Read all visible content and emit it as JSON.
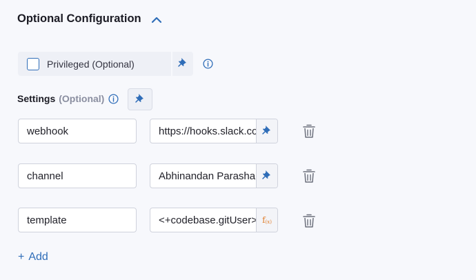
{
  "section": {
    "title": "Optional Configuration",
    "toggle_icon": "chevron-up-icon"
  },
  "privileged": {
    "label": "Privileged (Optional)",
    "checked": false
  },
  "settings": {
    "label": "Settings",
    "optional_label": "(Optional)"
  },
  "rows": [
    {
      "key": "webhook",
      "value": "https://hooks.slack.com",
      "value_mode": "pin-icon"
    },
    {
      "key": "channel",
      "value": "Abhinandan Parasharam",
      "value_mode": "pin-icon"
    },
    {
      "key": "template",
      "value": "<+codebase.gitUser>",
      "value_mode": "fx-icon"
    }
  ],
  "add": {
    "plus": "+",
    "label": "Add"
  },
  "colors": {
    "accent": "#2f6db8",
    "fx": "#e07b27",
    "background": "#f7f8fc"
  }
}
